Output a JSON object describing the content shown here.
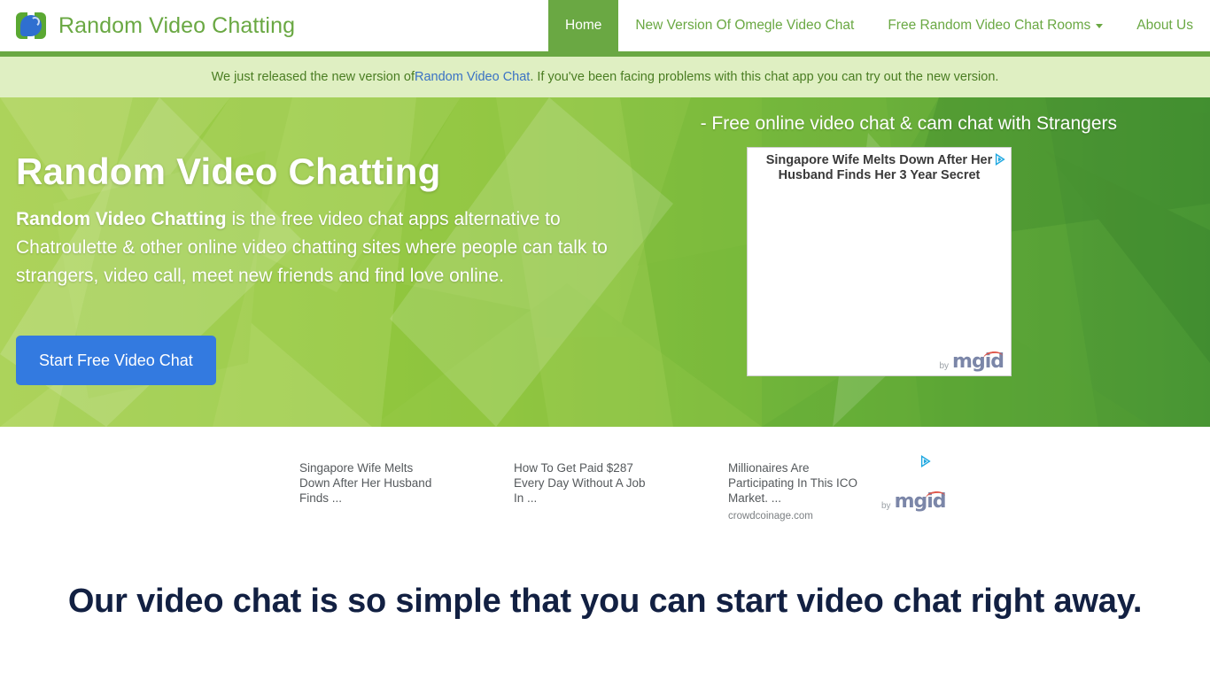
{
  "header": {
    "brand_name": "Random Video Chatting",
    "logo_icon": "chat-bubble-logo-icon",
    "nav_items": [
      {
        "label": "Home",
        "active": true,
        "has_caret": false
      },
      {
        "label": "New Version Of Omegle Video Chat",
        "active": false,
        "has_caret": false
      },
      {
        "label": "Free Random Video Chat Rooms",
        "active": false,
        "has_caret": true
      },
      {
        "label": "About Us",
        "active": false,
        "has_caret": false
      }
    ]
  },
  "alert": {
    "text_before": "We just released the new version of ",
    "link_text": "Random Video Chat",
    "text_after": ". If you've been facing problems with this chat app you can try out the new version.",
    "background_color": "#dfefc2",
    "text_color": "#4a7d22",
    "link_color": "#3a72c4"
  },
  "hero": {
    "tagline": "- Free online video chat & cam chat with Strangers",
    "title": "Random Video Chatting",
    "copy_bold": "Random Video Chatting",
    "copy_rest": " is the free video chat apps alternative to Chatroulette & other online video chatting sites where people can talk to strangers, video call, meet new friends and find love online.",
    "cta_label": "Start Free Video Chat",
    "cta_color": "#337ae0",
    "background_color": "#8ec63f"
  },
  "hero_ad": {
    "title": "Singapore Wife Melts Down After Her Husband Finds Her 3 Year Secret",
    "adchoices_icon": "adchoices-icon",
    "provider_by": "by",
    "provider_name": "mgid"
  },
  "ad_row": {
    "cards": [
      {
        "text": "Singapore Wife Melts Down After Her Husband Finds ...",
        "source": ""
      },
      {
        "text": "How To Get Paid $287 Every Day Without A Job In ...",
        "source": ""
      },
      {
        "text": "Millionaires Are Participating In This ICO Market. ...",
        "source": "crowdcoinage.com"
      }
    ],
    "adchoices_icon": "adchoices-icon",
    "provider_by": "by",
    "provider_name": "mgid"
  },
  "section": {
    "heading": "Our video chat is so simple that you can start video chat right away.",
    "heading_color": "#122042"
  }
}
